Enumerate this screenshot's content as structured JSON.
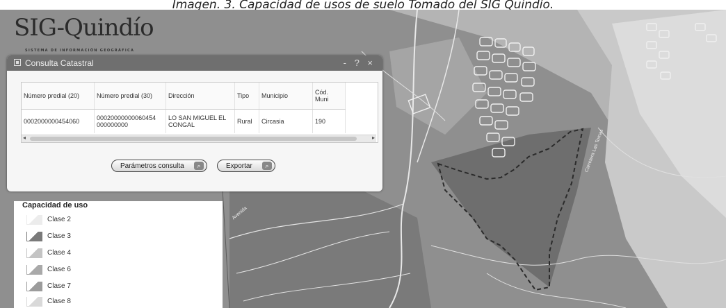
{
  "caption": "Imagen. 3. Capacidad de usos de suelo Tomado del SIG Quindío.",
  "logo": {
    "title": "SIG-Quindío",
    "subtitle": "SISTEMA DE INFORMACIÓN GEOGRÁFICA"
  },
  "dialog": {
    "title": "Consulta Catastral",
    "controls": "- ? ×",
    "columns": [
      "Número predial (20)",
      "Número predial (30)",
      "Dirección",
      "Tipo",
      "Municipio",
      "Cód. Muni"
    ],
    "rows": [
      [
        "0002000000454060",
        "00020000000060454 000000000",
        "LO SAN MIGUEL EL CONGAL",
        "Rural",
        "Circasia",
        "190"
      ]
    ],
    "btn_params": "Parámetros consulta",
    "btn_export": "Exportar"
  },
  "legend": {
    "title": "Capacidad de uso",
    "items": [
      {
        "label": "Clase 2",
        "color": "#ececec"
      },
      {
        "label": "Clase 3",
        "color": "#7a7a7a"
      },
      {
        "label": "Clase 4",
        "color": "#c4c4c4"
      },
      {
        "label": "Clase 6",
        "color": "#a9a9a9"
      },
      {
        "label": "Clase 7",
        "color": "#9c9c9c"
      },
      {
        "label": "Clase 8",
        "color": "#d9d9d9"
      }
    ]
  },
  "map_labels": {
    "road_1": "Avenida",
    "road_2": "Carretera Las Tomas"
  },
  "colors": {
    "parcel_boundary": "#2b2b2b",
    "dialog_header": "#6f6f6f"
  }
}
